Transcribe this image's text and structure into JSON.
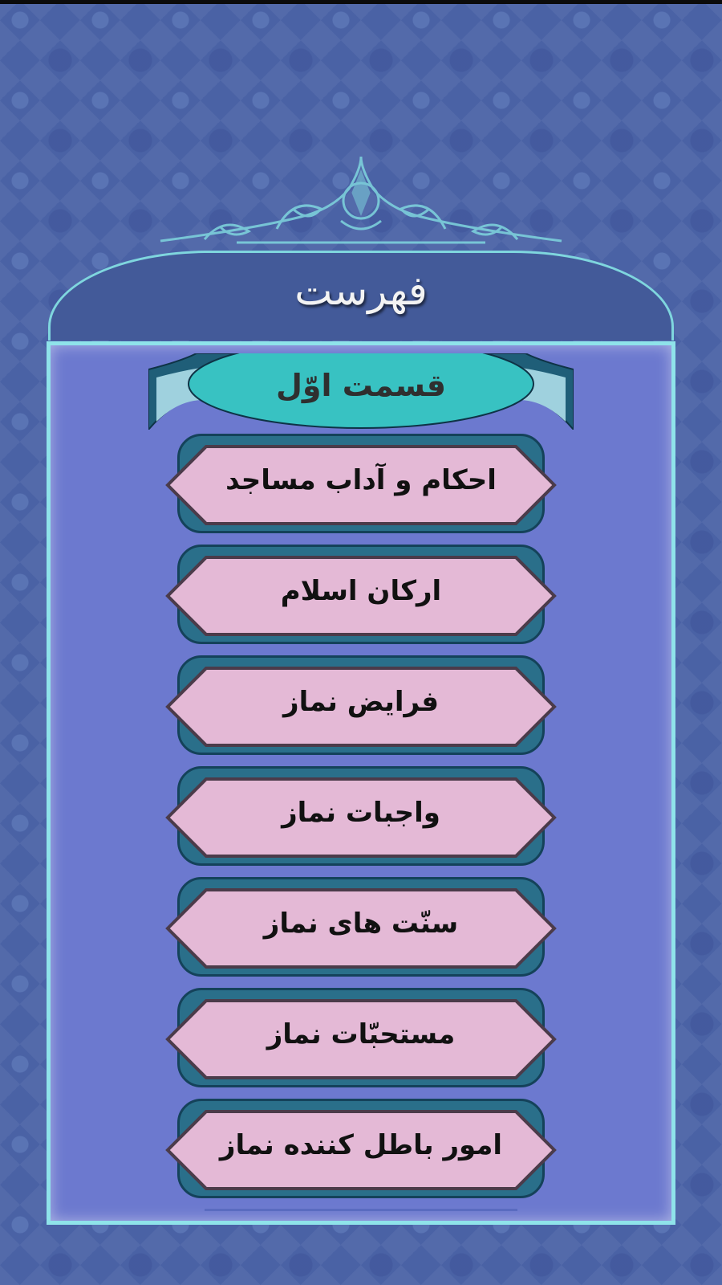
{
  "header": {
    "title": "فهرست"
  },
  "section": {
    "label": "قسمت اوّل"
  },
  "menu": {
    "items": [
      {
        "label": "احکام و آداب مساجد"
      },
      {
        "label": "ارکان اسلام"
      },
      {
        "label": "فرایض نماز"
      },
      {
        "label": "واجبات نماز"
      },
      {
        "label": "سنّت های نماز"
      },
      {
        "label": "مستحبّات نماز"
      },
      {
        "label": "امور باطل کننده نماز"
      }
    ]
  },
  "colors": {
    "background": "#4a62a5",
    "panel": "#6c79cf",
    "panel_border": "#8fe3ea",
    "button_fill": "#e4b9d6",
    "button_frame": "#2a6f8a",
    "banner_fill": "#38c2c2"
  }
}
